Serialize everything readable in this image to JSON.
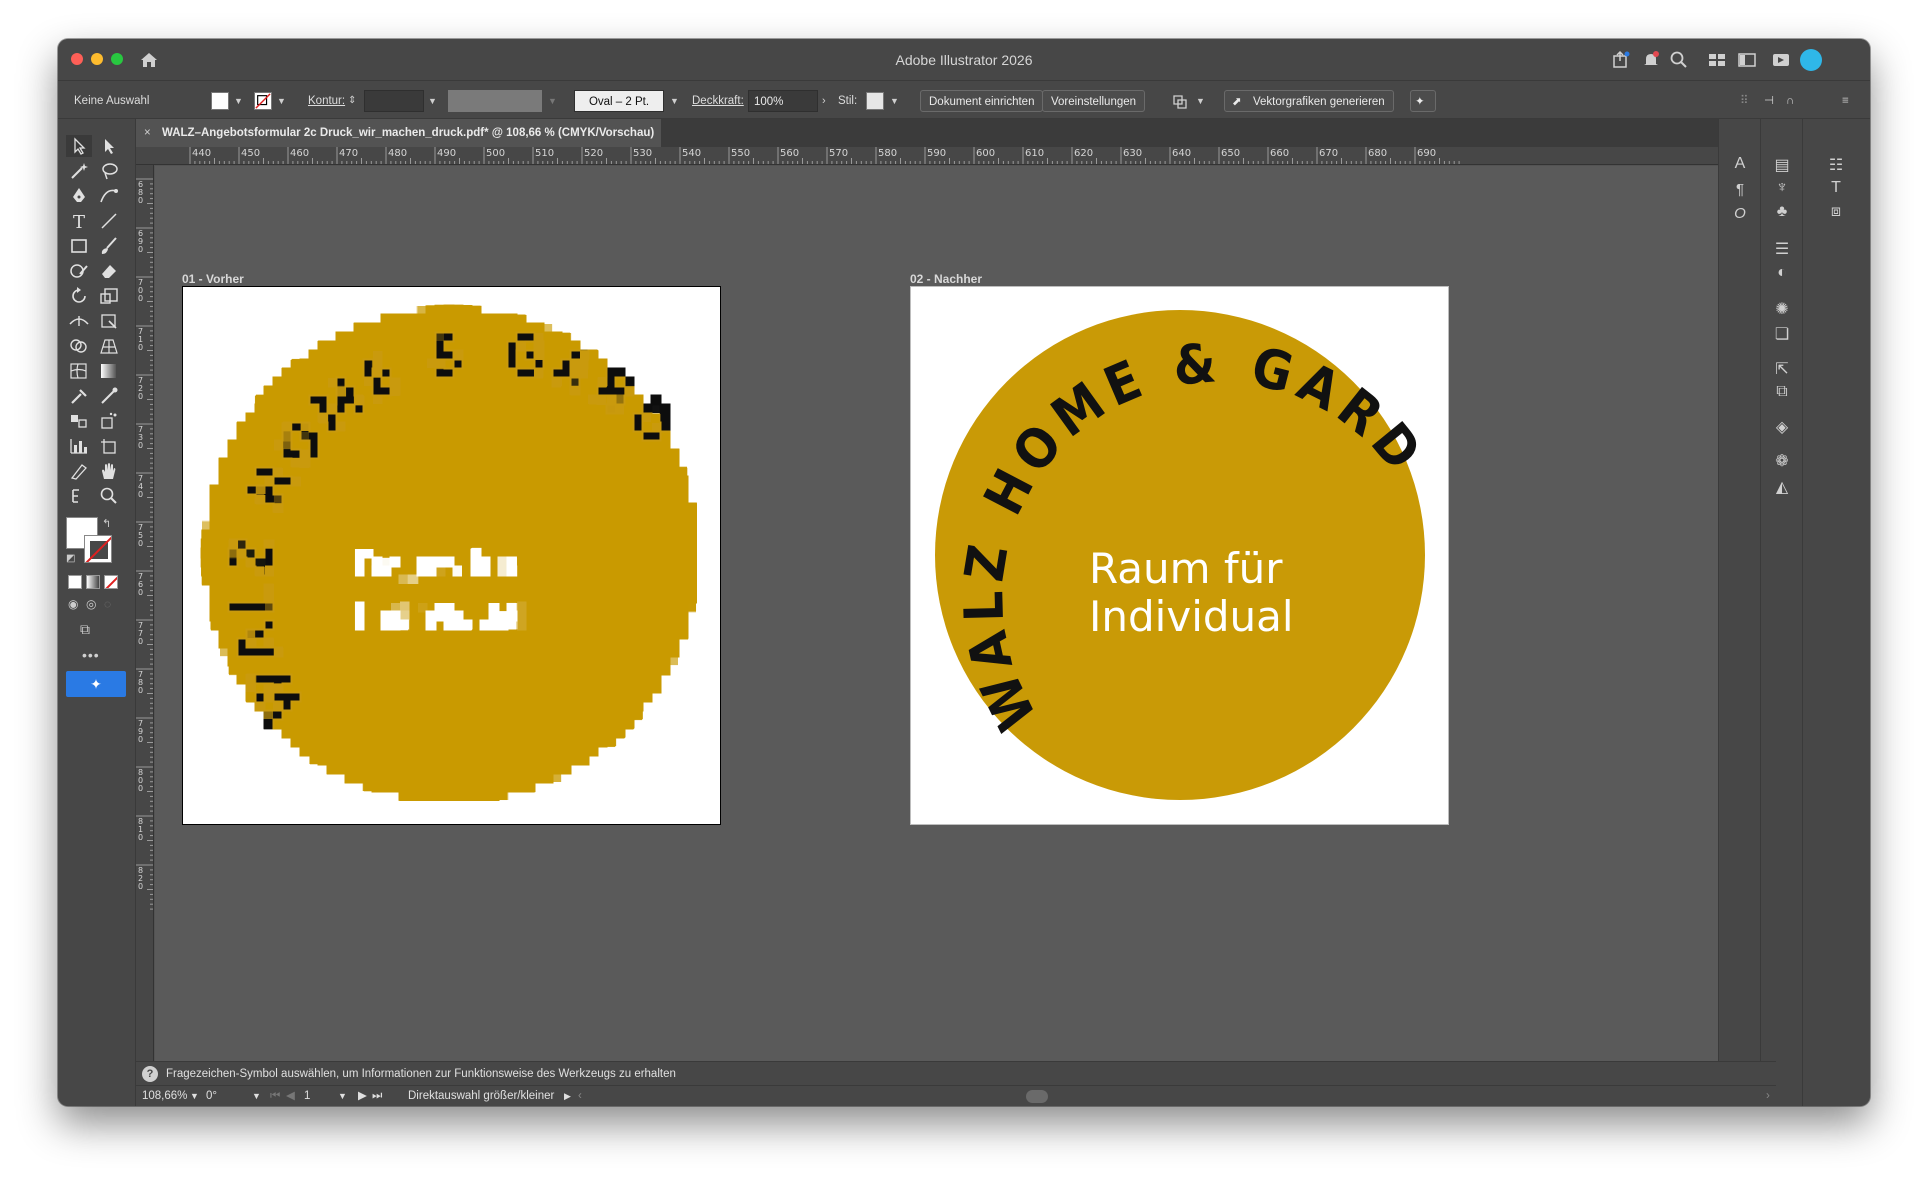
{
  "app": {
    "title": "Adobe Illustrator 2026"
  },
  "control_bar": {
    "selection": "Keine Auswahl",
    "stroke_label": "Kontur:",
    "brush_label": "Oval – 2 Pt.",
    "opacity_label": "Deckkraft:",
    "opacity_value": "100%",
    "style_label": "Stil:",
    "doc_setup_button": "Dokument einrichten",
    "preferences_button": "Voreinstellungen",
    "generate_vectors_button": "Vektorgrafiken generieren"
  },
  "document": {
    "tab_title": "WALZ–Angebotsformular 2c Druck_wir_machen_druck.pdf* @ 108,66 % (CMYK/Vorschau)",
    "close_glyph": "×"
  },
  "rulers": {
    "horizontal": [
      "440",
      "450",
      "460",
      "470",
      "480",
      "490",
      "500",
      "510",
      "520",
      "530",
      "540",
      "550",
      "560",
      "570",
      "580",
      "590",
      "600",
      "610",
      "620",
      "630",
      "640",
      "650",
      "660",
      "670",
      "680",
      "690"
    ],
    "vertical": [
      "680",
      "690",
      "700",
      "710",
      "720",
      "730",
      "740",
      "750",
      "760",
      "770",
      "780",
      "790",
      "800",
      "810",
      "820"
    ]
  },
  "artboards": [
    {
      "label": "01 - Vorher",
      "arc_text": "WALZ HOME & GARDEN",
      "line1": "Raum für",
      "line2": "Individual"
    },
    {
      "label": "02 - Nachher",
      "arc_text": "WALZ HOME & GARDEN",
      "line1": "Raum für",
      "line2": "Individual"
    }
  ],
  "colors": {
    "badge": "#C99A06",
    "canvas": "#5A5A5A",
    "ui_dark": "#474747",
    "accent_blue": "#2A7AE4"
  },
  "hint_bar": {
    "text": "Fragezeichen-Symbol auswählen, um Informationen zur Funktionsweise des Werkzeugs zu erhalten"
  },
  "status_bar": {
    "zoom": "108,66%",
    "rotation": "0°",
    "artboard_number": "1",
    "tool_info": "Direktauswahl größer/kleiner"
  }
}
